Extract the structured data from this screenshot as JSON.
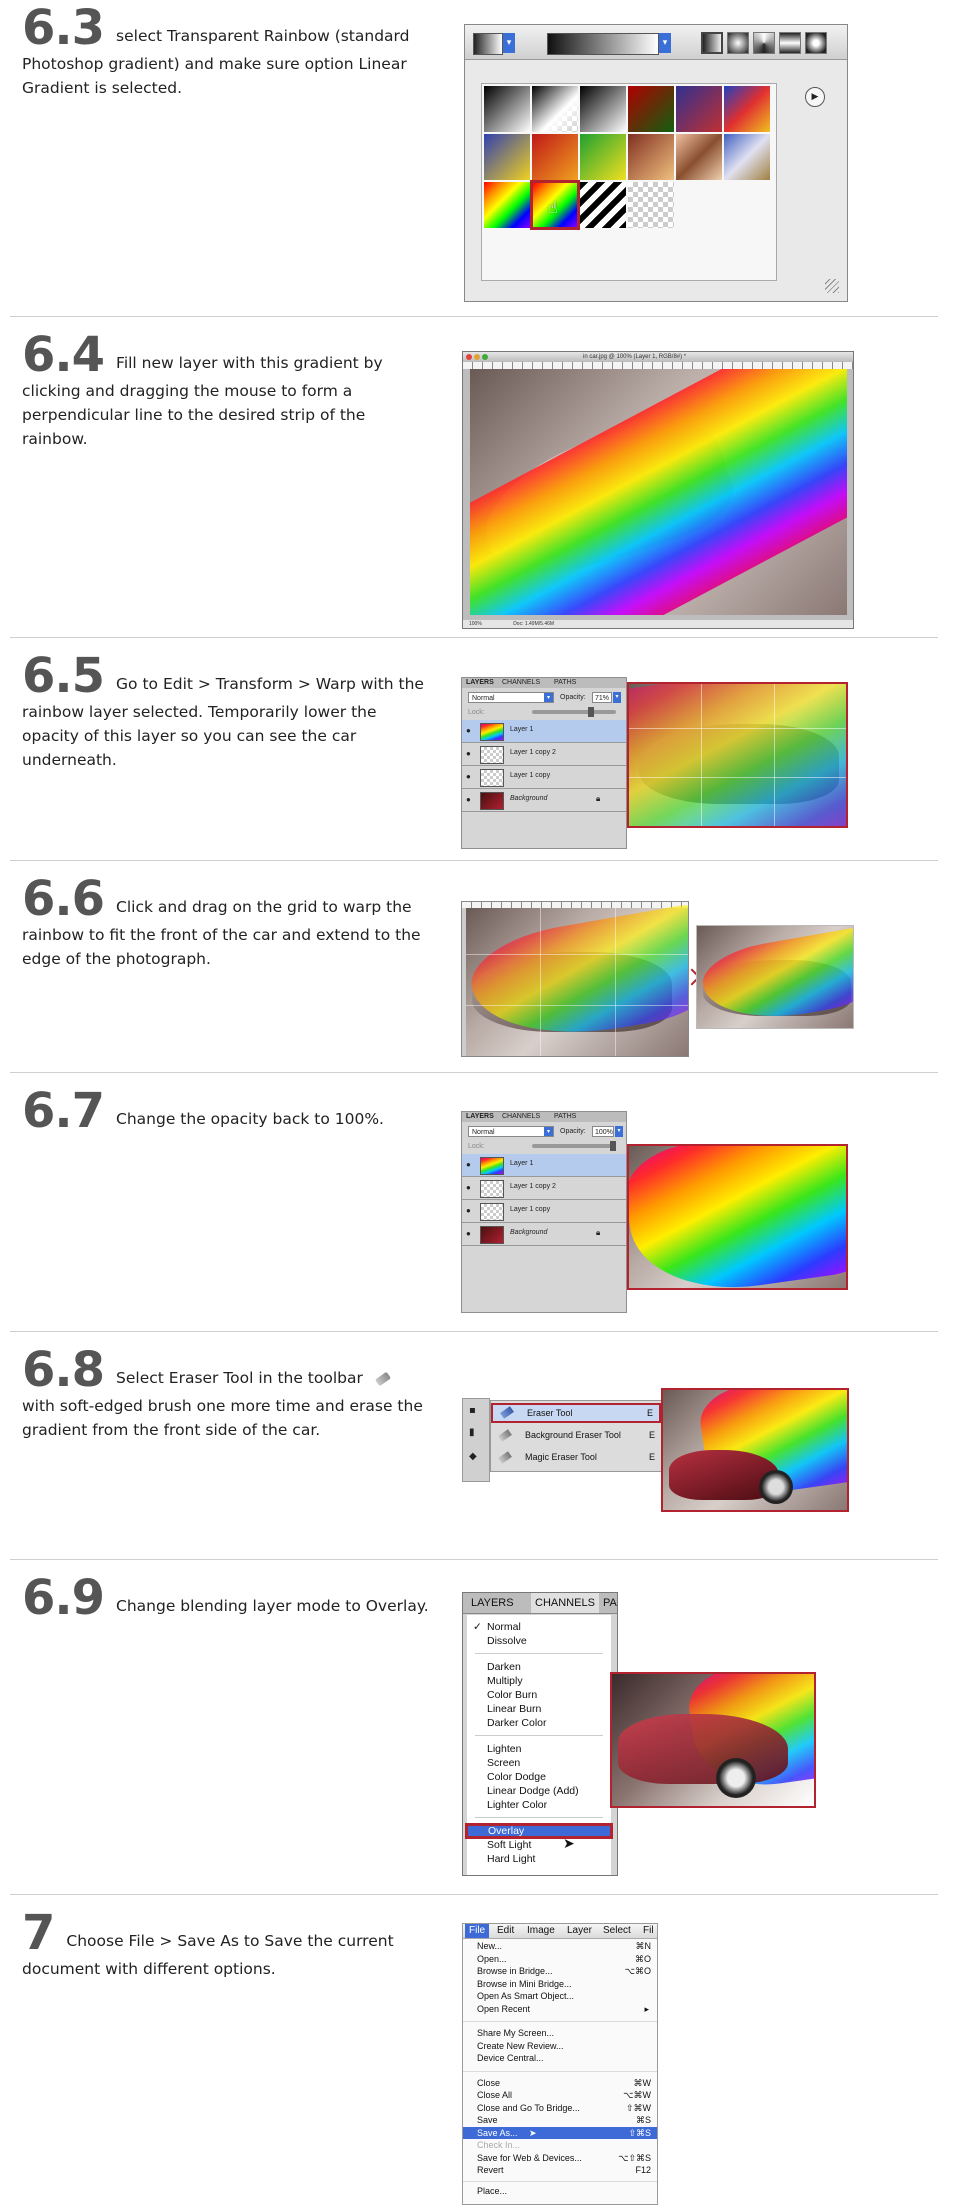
{
  "steps": [
    {
      "id": "6.3",
      "num": "6.3",
      "text": "select Transparent Rainbow (standard Photoshop gradient) and make sure option Linear Gradient is selected."
    },
    {
      "id": "6.4",
      "num": "6.4",
      "text": "Fill new layer with this gradient by clicking and dragging the mouse to form a perpendicular line to the desired strip of the rainbow."
    },
    {
      "id": "6.5",
      "num": "6.5",
      "text": "Go to Edit > Transform > Warp with the rainbow layer selected. Temporarily lower the opacity of this layer so you can see the car underneath."
    },
    {
      "id": "6.6",
      "num": "6.6",
      "text": "Click and drag on the grid to warp the rainbow to fit the front of the car and extend to the edge of the photograph."
    },
    {
      "id": "6.7",
      "num": "6.7",
      "text": "Change the opacity back to 100%."
    },
    {
      "id": "6.8",
      "num": "6.8",
      "text": "Select Eraser Tool in the toolbar",
      "text2": "with soft-edged brush one more time and erase the gradient from the front side of the car."
    },
    {
      "id": "6.9",
      "num": "6.9",
      "text": "Change blending layer mode to Overlay."
    },
    {
      "id": "7",
      "num": "7",
      "text": "Choose File > Save As to Save the current document with different options."
    }
  ],
  "layers_panel_1": {
    "tabs": [
      "LAYERS",
      "CHANNELS",
      "PATHS"
    ],
    "mode": "Normal",
    "opacity_label": "Opacity:",
    "opacity_value": "71%",
    "lock_label": "Lock:",
    "layers": [
      "Layer 1",
      "Layer 1 copy 2",
      "Layer 1 copy",
      "Background"
    ]
  },
  "layers_panel_2": {
    "tabs": [
      "LAYERS",
      "CHANNELS",
      "PATHS"
    ],
    "mode": "Normal",
    "opacity_label": "Opacity:",
    "opacity_value": "100%",
    "lock_label": "Lock:",
    "layers": [
      "Layer 1",
      "Layer 1 copy 2",
      "Layer 1 copy",
      "Background"
    ]
  },
  "eraser_menu": {
    "items": [
      {
        "label": "Eraser Tool",
        "key": "E"
      },
      {
        "label": "Background Eraser Tool",
        "key": "E"
      },
      {
        "label": "Magic Eraser Tool",
        "key": "E"
      }
    ]
  },
  "blend_menu": {
    "tabs": [
      "LAYERS",
      "CHANNELS",
      "PA"
    ],
    "groups": [
      [
        "Normal",
        "Dissolve"
      ],
      [
        "Darken",
        "Multiply",
        "Color Burn",
        "Linear Burn",
        "Darker Color"
      ],
      [
        "Lighten",
        "Screen",
        "Color Dodge",
        "Linear Dodge (Add)",
        "Lighter Color"
      ],
      [
        "Overlay",
        "Soft Light",
        "Hard Light"
      ]
    ],
    "checked": "Normal",
    "selected": "Overlay"
  },
  "file_menu": {
    "menubar": [
      "File",
      "Edit",
      "Image",
      "Layer",
      "Select",
      "Fil"
    ],
    "items": [
      {
        "label": "New...",
        "key": "⌘N"
      },
      {
        "label": "Open...",
        "key": "⌘O"
      },
      {
        "label": "Browse in Bridge...",
        "key": "⌥⌘O"
      },
      {
        "label": "Browse in Mini Bridge...",
        "key": ""
      },
      {
        "label": "Open As Smart Object...",
        "key": ""
      },
      {
        "label": "Open Recent",
        "key": "▸"
      },
      {
        "label": "",
        "key": ""
      },
      {
        "label": "Share My Screen...",
        "key": ""
      },
      {
        "label": "Create New Review...",
        "key": ""
      },
      {
        "label": "Device Central...",
        "key": ""
      },
      {
        "label": "",
        "key": ""
      },
      {
        "label": "Close",
        "key": "⌘W"
      },
      {
        "label": "Close All",
        "key": "⌥⌘W"
      },
      {
        "label": "Close and Go To Bridge...",
        "key": "⇧⌘W"
      },
      {
        "label": "Save",
        "key": "⌘S"
      },
      {
        "label": "Save As...",
        "key": "⇧⌘S"
      },
      {
        "label": "Check In...",
        "key": ""
      },
      {
        "label": "Save for Web & Devices...",
        "key": "⌥⇧⌘S"
      },
      {
        "label": "Revert",
        "key": "F12"
      },
      {
        "label": "",
        "key": ""
      },
      {
        "label": "Place...",
        "key": ""
      }
    ],
    "selected": "Save As..."
  },
  "doc_window": {
    "title": "in car.jpg @ 100% (Layer 1, RGB/8#) *",
    "status_zoom": "100%",
    "status_doc": "Doc: 1.49M/5.46M"
  },
  "colors": {
    "accent_red": "#b3222f",
    "panel_gray": "#d6d6d6",
    "menu_highlight": "#3d6ad6",
    "number_gray": "#555555"
  }
}
